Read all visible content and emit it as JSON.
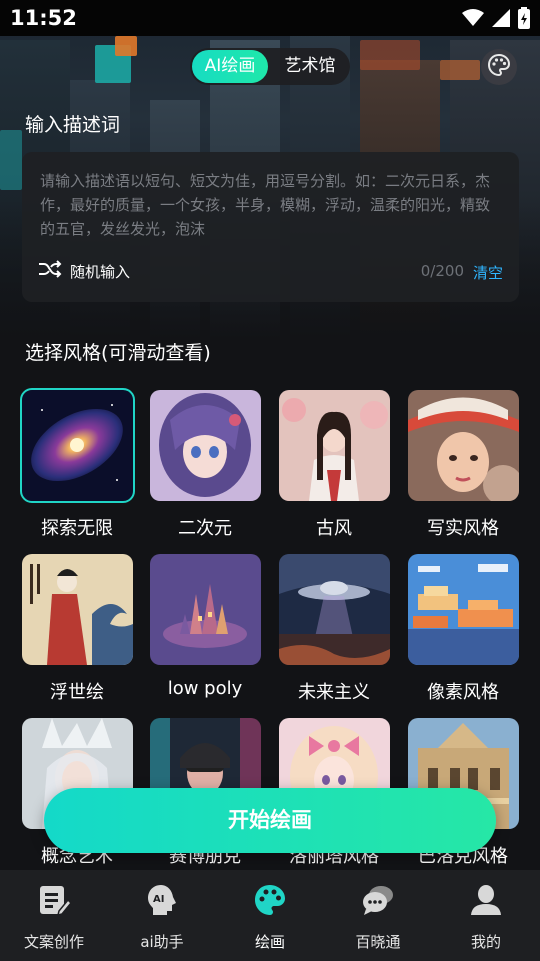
{
  "status_bar": {
    "time": "11:52"
  },
  "top_tabs": [
    {
      "label": "AI绘画",
      "active": true
    },
    {
      "label": "艺术馆",
      "active": false
    }
  ],
  "prompt_section": {
    "title": "输入描述词",
    "placeholder": "请输入描述语以短句、短文为佳，用逗号分割。如：二次元日系，杰作，最好的质量，一个女孩，半身，模糊，浮动，温柔的阳光，精致的五官，发丝发光，泡沫",
    "random_label": "随机输入",
    "counter": "0/200",
    "clear_label": "清空"
  },
  "style_section": {
    "title": "选择风格(可滑动查看)"
  },
  "styles": [
    {
      "label": "探索无限",
      "icon": "galaxy-image",
      "selected": true
    },
    {
      "label": "二次元",
      "icon": "anime-girl-image",
      "selected": false
    },
    {
      "label": "古风",
      "icon": "ancient-style-girl-image",
      "selected": false
    },
    {
      "label": "写实风格",
      "icon": "realistic-portrait-image",
      "selected": false
    },
    {
      "label": "浮世绘",
      "icon": "ukiyoe-image",
      "selected": false
    },
    {
      "label": "low poly",
      "icon": "low-poly-castle-image",
      "selected": false
    },
    {
      "label": "未来主义",
      "icon": "ufo-city-image",
      "selected": false
    },
    {
      "label": "像素风格",
      "icon": "pixel-clouds-image",
      "selected": false
    },
    {
      "label": "概念艺术",
      "icon": "concept-art-image",
      "selected": false
    },
    {
      "label": "赛博朋克",
      "icon": "cyberpunk-image",
      "selected": false
    },
    {
      "label": "洛丽塔风格",
      "icon": "lolita-image",
      "selected": false
    },
    {
      "label": "巴洛克风格",
      "icon": "baroque-image",
      "selected": false
    }
  ],
  "start_button": {
    "label": "开始绘画"
  },
  "bottom_nav": [
    {
      "label": "文案创作",
      "icon": "edit-document-icon",
      "active": false
    },
    {
      "label": "ai助手",
      "icon": "ai-head-icon",
      "active": false
    },
    {
      "label": "绘画",
      "icon": "palette-icon",
      "active": true
    },
    {
      "label": "百晓通",
      "icon": "chat-bubbles-icon",
      "active": false
    },
    {
      "label": "我的",
      "icon": "user-icon",
      "active": false
    }
  ],
  "colors": {
    "accent": "#1fe0b8",
    "selection_border": "#20d5c6",
    "clear_link": "#2fb6ff",
    "nav_active_icon": "#20d5c6"
  }
}
